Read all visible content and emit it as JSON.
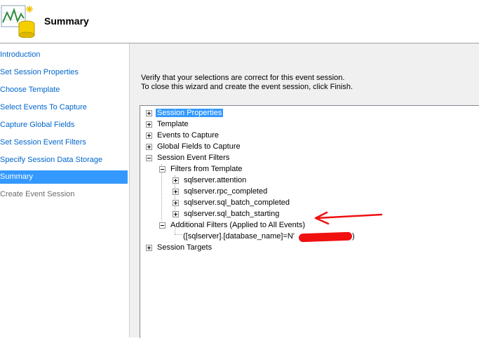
{
  "header": {
    "title": "Summary",
    "icon": "performance-database-icon"
  },
  "nav": {
    "items": [
      {
        "label": "Introduction",
        "state": "link"
      },
      {
        "label": "Set Session Properties",
        "state": "link"
      },
      {
        "label": "Choose Template",
        "state": "link"
      },
      {
        "label": "Select Events To Capture",
        "state": "link"
      },
      {
        "label": "Capture Global Fields",
        "state": "link"
      },
      {
        "label": "Set Session Event Filters",
        "state": "link"
      },
      {
        "label": "Specify Session Data Storage",
        "state": "link"
      },
      {
        "label": "Summary",
        "state": "selected"
      },
      {
        "label": "Create Event Session",
        "state": "disabled"
      }
    ]
  },
  "main": {
    "intro_line1": "Verify that your selections are correct for this event session.",
    "intro_line2": "To close this wizard and create the event session, click Finish.",
    "tree": {
      "session_properties": "Session Properties",
      "template": "Template",
      "events_to_capture": "Events to Capture",
      "global_fields": "Global Fields to Capture",
      "session_event_filters": "Session Event Filters",
      "filters_from_template": "Filters from Template",
      "filter_attention": "sqlserver.attention",
      "filter_rpc_completed": "sqlserver.rpc_completed",
      "filter_sql_batch_completed": "sqlserver.sql_batch_completed",
      "filter_sql_batch_starting": "sqlserver.sql_batch_starting",
      "additional_filters": "Additional Filters (Applied to All Events)",
      "database_filter": "([sqlserver].[database_name]=N'",
      "database_filter_end": ")",
      "session_targets": "Session Targets"
    }
  },
  "colors": {
    "selection": "#3399ff",
    "link": "#0066cc",
    "annotation": "#f01010"
  }
}
